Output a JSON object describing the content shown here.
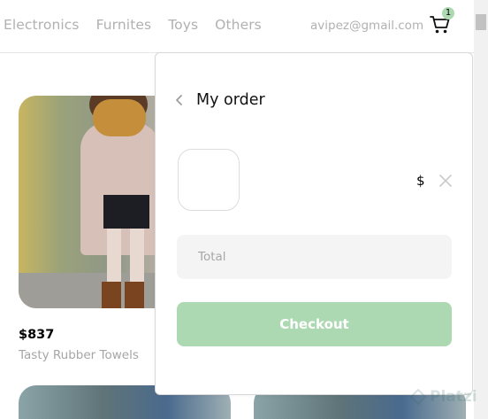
{
  "navbar": {
    "links": [
      "Electronics",
      "Furnites",
      "Toys",
      "Others"
    ],
    "email": "avipez@gmail.com",
    "cart_count": "1",
    "accent_color": "#acd9b2"
  },
  "products": [
    {
      "price": "$837",
      "title": "Tasty Rubber Towels"
    }
  ],
  "order": {
    "title": "My order",
    "item_price": "$",
    "total_label": "Total",
    "checkout_label": "Checkout",
    "checkout_color": "#acd9b2"
  },
  "watermark": {
    "text": "Platzi"
  }
}
